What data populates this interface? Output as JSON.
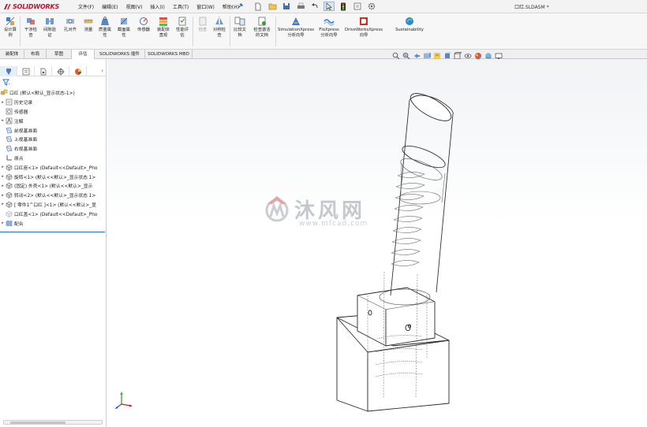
{
  "app": {
    "brand": "SOLIDWORKS",
    "document_title": "口红.SLDASM *"
  },
  "menu": {
    "items": [
      "文件(F)",
      "编辑(E)",
      "视图(V)",
      "插入(I)",
      "工具(T)",
      "窗口(W)",
      "帮助(H)"
    ]
  },
  "ribbon": {
    "design_study": "设计算\n例",
    "interference": "干涉检\n查",
    "clearance": "间隙验\n证",
    "hole_align": "孔对齐",
    "measure": "测量",
    "mass_props": "质量属\n性",
    "section_props": "截面属\n性",
    "sensor": "传感器",
    "assembly_vis": "装配体\n直观",
    "performance": "性能评\n估",
    "check": "检查",
    "symmetry": "对称检\n查",
    "compare": "比较文\n档",
    "check_active": "检查激活\n的文档",
    "simulation_xpress": "SimulationXpress\n分析向导",
    "flo_xpress": "FloXpress\n分析向导",
    "driveworks": "DriveWorksXpress\n向导",
    "sustainability": "Sustainability"
  },
  "command_tabs": [
    "装配体",
    "布局",
    "草图",
    "评估",
    "SOLIDWORKS 插件",
    "SOLIDWORKS MBD"
  ],
  "active_command_tab": "评估",
  "feature_tree": {
    "root": "口红 (默认<默认_显示状态-1>)",
    "items": [
      {
        "label": "历史记录",
        "icon": "history-icon",
        "expand": "▸"
      },
      {
        "label": "传感器",
        "icon": "sensor-icon",
        "expand": ""
      },
      {
        "label": "注解",
        "icon": "annotation-icon",
        "expand": "▸"
      },
      {
        "label": "前视基准面",
        "icon": "plane-icon",
        "expand": ""
      },
      {
        "label": "上视基准面",
        "icon": "plane-icon",
        "expand": ""
      },
      {
        "label": "右视基准面",
        "icon": "plane-icon",
        "expand": ""
      },
      {
        "label": "原点",
        "icon": "origin-icon",
        "expand": ""
      },
      {
        "label": "口红座<1> (Default<<Default>_Pho",
        "icon": "part-icon",
        "expand": "▸"
      },
      {
        "label": "旋转<1> (默认<<默认>_显示状态 1>",
        "icon": "part-icon",
        "expand": "▸"
      },
      {
        "label": "(固定) 外壳<1> (默认<<默认>_显示",
        "icon": "part-icon",
        "expand": "▸"
      },
      {
        "label": "转动<2> (默认<<默认>_显示状态 1>",
        "icon": "part-icon",
        "expand": "▸"
      },
      {
        "label": "[ 零件1^口红 ]<1> (默认<<默认>_显",
        "icon": "part-icon",
        "expand": "▸"
      },
      {
        "label": "口红盖<1> (Default<<Default>_Pho",
        "icon": "part-gray-icon",
        "expand": ""
      },
      {
        "label": "配合",
        "icon": "mate-icon",
        "expand": "▸"
      }
    ]
  },
  "watermark": {
    "text": "沐风网",
    "url": "www.mfcad.com"
  },
  "colors": {
    "brand_red": "#c8102e",
    "accent_blue": "#2d6cc0"
  }
}
